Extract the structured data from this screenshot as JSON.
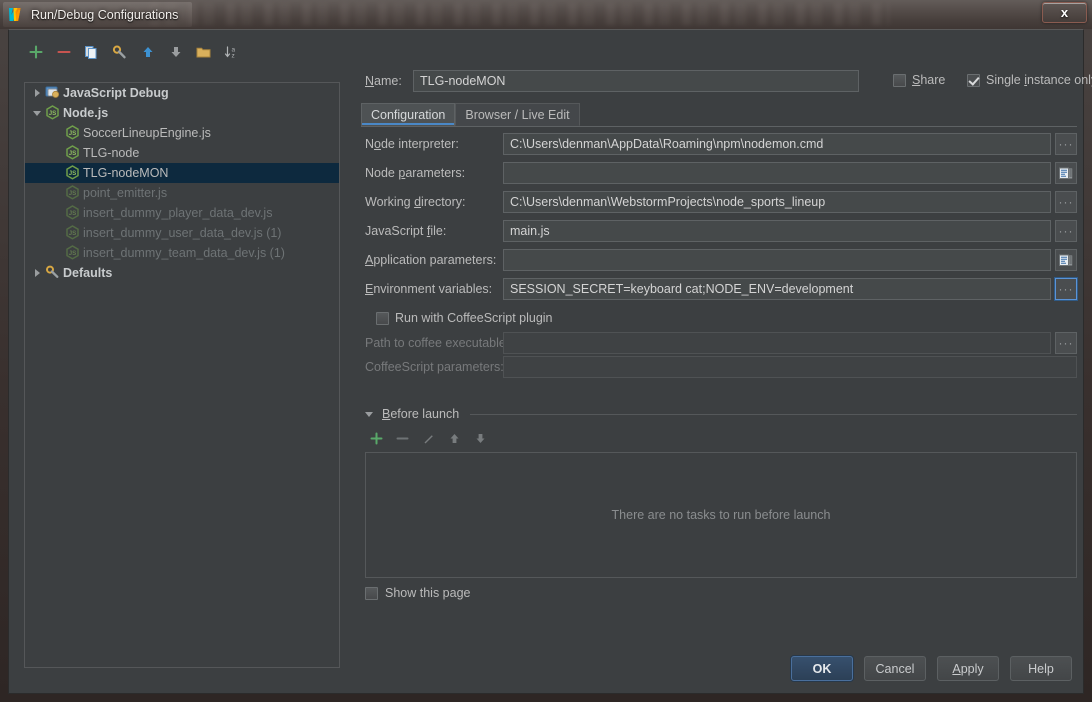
{
  "window": {
    "title": "Run/Debug Configurations",
    "app_icon": "webstorm-logo-icon",
    "close_label": "x"
  },
  "tree_toolbar": {
    "buttons": [
      {
        "name": "add-configuration-button",
        "icon": "plus-icon"
      },
      {
        "name": "remove-configuration-button",
        "icon": "minus-icon"
      },
      {
        "name": "copy-configuration-button",
        "icon": "copy-icon"
      },
      {
        "name": "edit-defaults-button",
        "icon": "wrench-icon"
      },
      {
        "name": "move-up-button",
        "icon": "arrow-up-icon"
      },
      {
        "name": "move-down-button",
        "icon": "arrow-down-icon"
      },
      {
        "name": "create-folder-button",
        "icon": "folder-icon"
      },
      {
        "name": "sort-configurations-button",
        "icon": "sort-az-icon"
      }
    ]
  },
  "tree": {
    "nodes": [
      {
        "label": "JavaScript Debug",
        "level": 1,
        "twisty": "right",
        "icon": "javascript-debug-icon",
        "bold": true,
        "dim": false,
        "selected": false
      },
      {
        "label": "Node.js",
        "level": 1,
        "twisty": "down",
        "icon": "nodejs-icon",
        "bold": true,
        "dim": false,
        "selected": false
      },
      {
        "label": "SoccerLineupEngine.js",
        "level": 2,
        "twisty": "none",
        "icon": "nodejs-icon",
        "bold": false,
        "dim": false,
        "selected": false
      },
      {
        "label": "TLG-node",
        "level": 2,
        "twisty": "none",
        "icon": "nodejs-icon",
        "bold": false,
        "dim": false,
        "selected": false
      },
      {
        "label": "TLG-nodeMON",
        "level": 2,
        "twisty": "none",
        "icon": "nodejs-icon",
        "bold": false,
        "dim": false,
        "selected": true
      },
      {
        "label": "point_emitter.js",
        "level": 2,
        "twisty": "none",
        "icon": "nodejs-icon",
        "bold": false,
        "dim": true,
        "selected": false
      },
      {
        "label": "insert_dummy_player_data_dev.js",
        "level": 2,
        "twisty": "none",
        "icon": "nodejs-icon",
        "bold": false,
        "dim": true,
        "selected": false
      },
      {
        "label": "insert_dummy_user_data_dev.js (1)",
        "level": 2,
        "twisty": "none",
        "icon": "nodejs-icon",
        "bold": false,
        "dim": true,
        "selected": false
      },
      {
        "label": "insert_dummy_team_data_dev.js (1)",
        "level": 2,
        "twisty": "none",
        "icon": "nodejs-icon",
        "bold": false,
        "dim": true,
        "selected": false
      },
      {
        "label": "Defaults",
        "level": 1,
        "twisty": "right",
        "icon": "defaults-wrench-icon",
        "bold": true,
        "dim": false,
        "selected": false
      }
    ]
  },
  "name_row": {
    "label": "Name:",
    "label_mnemonic": "N",
    "value": "TLG-nodeMON",
    "share": {
      "label": "Share",
      "mnemonic": "S",
      "checked": false
    },
    "single_instance": {
      "label": "Single instance only",
      "mnemonic": "i",
      "checked": true
    }
  },
  "tabs": [
    {
      "label": "Configuration",
      "active": true
    },
    {
      "label": "Browser / Live Edit",
      "active": false
    }
  ],
  "form": {
    "rows": [
      {
        "name": "node-interpreter",
        "label": "Node interpreter:",
        "value": "C:\\Users\\denman\\AppData\\Roaming\\npm\\nodemon.cmd",
        "disabled": false,
        "trailing": "ellipsis",
        "trailing_focused": false
      },
      {
        "name": "node-parameters",
        "label": "Node parameters:",
        "value": "",
        "disabled": false,
        "trailing": "expand",
        "trailing_focused": false
      },
      {
        "name": "working-directory",
        "label": "Working directory:",
        "value": "C:\\Users\\denman\\WebstormProjects\\node_sports_lineup",
        "disabled": false,
        "trailing": "ellipsis",
        "trailing_focused": false
      },
      {
        "name": "javascript-file",
        "label": "JavaScript file:",
        "value": "main.js",
        "disabled": false,
        "trailing": "ellipsis",
        "trailing_focused": false
      },
      {
        "name": "application-parameters",
        "label": "Application parameters:",
        "value": "",
        "disabled": false,
        "trailing": "expand",
        "trailing_focused": false
      },
      {
        "name": "environment-variables",
        "label": "Environment variables:",
        "value": "SESSION_SECRET=keyboard cat;NODE_ENV=development",
        "disabled": false,
        "trailing": "ellipsis",
        "trailing_focused": true
      }
    ],
    "coffee_checkbox": {
      "label": "Run with CoffeeScript plugin",
      "checked": false
    },
    "coffee_rows": [
      {
        "name": "path-to-coffee-executable",
        "label": "Path to coffee executable:",
        "value": "",
        "trailing": "ellipsis"
      },
      {
        "name": "coffeescript-parameters",
        "label": "CoffeeScript parameters:",
        "value": "",
        "trailing": "none"
      }
    ]
  },
  "before_launch": {
    "title": "Before launch",
    "title_mnemonic": "B",
    "toolbar": [
      {
        "name": "add-task-button",
        "icon": "plus-icon",
        "enabled": true
      },
      {
        "name": "remove-task-button",
        "icon": "minus-icon",
        "enabled": false
      },
      {
        "name": "edit-task-button",
        "icon": "pencil-icon",
        "enabled": false
      },
      {
        "name": "move-task-up-button",
        "icon": "arrow-up-icon",
        "enabled": false
      },
      {
        "name": "move-task-down-button",
        "icon": "arrow-down-icon",
        "enabled": false
      }
    ],
    "empty_text": "There are no tasks to run before launch",
    "show_page": {
      "label": "Show this page",
      "checked": false
    }
  },
  "buttons": [
    {
      "name": "ok-button",
      "label": "OK",
      "primary": true
    },
    {
      "name": "cancel-button",
      "label": "Cancel",
      "primary": false
    },
    {
      "name": "apply-button",
      "label": "Apply",
      "primary": false,
      "mnemonic": "A"
    },
    {
      "name": "help-button",
      "label": "Help",
      "primary": false
    }
  ],
  "colors": {
    "panel_bg": "#3c3f41",
    "field_bg": "#45494a",
    "selection_bg": "#0d293e",
    "accent_blue": "#4a88c7",
    "green": "#4caf50",
    "red": "#c75450",
    "text": "#bbbbbb",
    "text_dim": "#6e7375"
  }
}
